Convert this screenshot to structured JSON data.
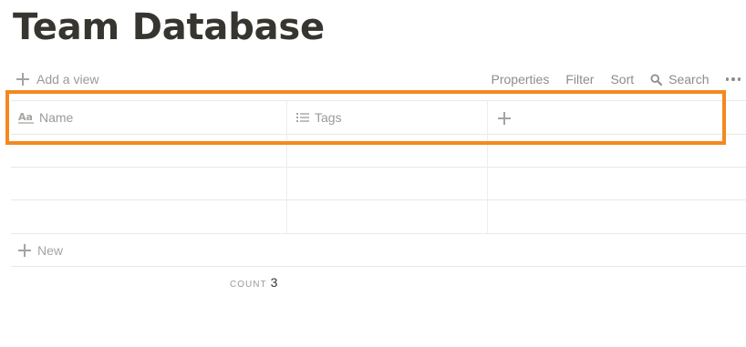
{
  "page": {
    "title": "Team Database"
  },
  "toolbar": {
    "add_view_label": "Add a view",
    "properties_label": "Properties",
    "filter_label": "Filter",
    "sort_label": "Sort",
    "search_label": "Search"
  },
  "table": {
    "columns": [
      {
        "name": "Name",
        "icon": "text-type-icon"
      },
      {
        "name": "Tags",
        "icon": "list-icon"
      }
    ],
    "add_column_icon": "plus-icon",
    "rows": [
      {
        "name": "",
        "tags": ""
      },
      {
        "name": "",
        "tags": ""
      },
      {
        "name": "",
        "tags": ""
      }
    ],
    "new_row_label": "New"
  },
  "footer": {
    "count_label": "COUNT",
    "count_value": "3"
  },
  "colors": {
    "highlight": "#f4891f",
    "text": "#37352f",
    "muted": "#9b9a97",
    "border": "#e9e9e7"
  }
}
